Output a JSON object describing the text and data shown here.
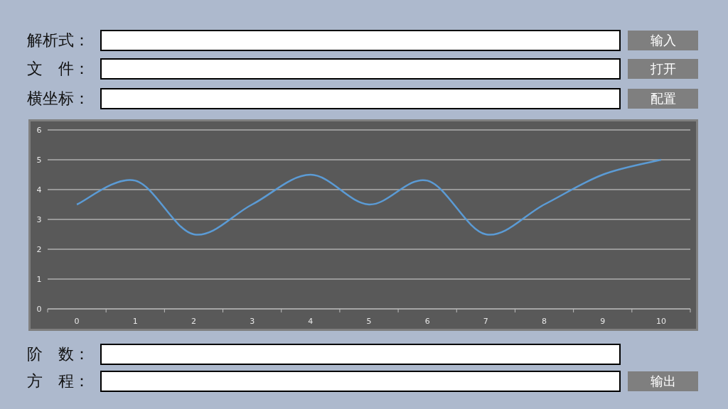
{
  "top_fields": [
    {
      "label": "解析式：",
      "button": "输入"
    },
    {
      "label": "文　件：",
      "button": "打开"
    },
    {
      "label": "横坐标：",
      "button": "配置"
    }
  ],
  "chart": {
    "chart_data": {
      "type": "line",
      "categories": [
        "0",
        "1",
        "2",
        "3",
        "4",
        "5",
        "6",
        "7",
        "8",
        "9",
        "10"
      ],
      "series": [
        {
          "color": "#5b9bd5",
          "values": [
            3.5,
            4.3,
            2.5,
            3.5,
            4.5,
            3.5,
            4.3,
            2.5,
            3.5,
            4.5,
            5
          ]
        }
      ],
      "ylim": [
        0,
        6
      ],
      "grid": true,
      "yticks": [
        0,
        1,
        2,
        3,
        4,
        5,
        6
      ]
    }
  },
  "bottom_fields": [
    {
      "label": "阶　数："
    },
    {
      "label": "方　程：",
      "button": "输出"
    }
  ]
}
